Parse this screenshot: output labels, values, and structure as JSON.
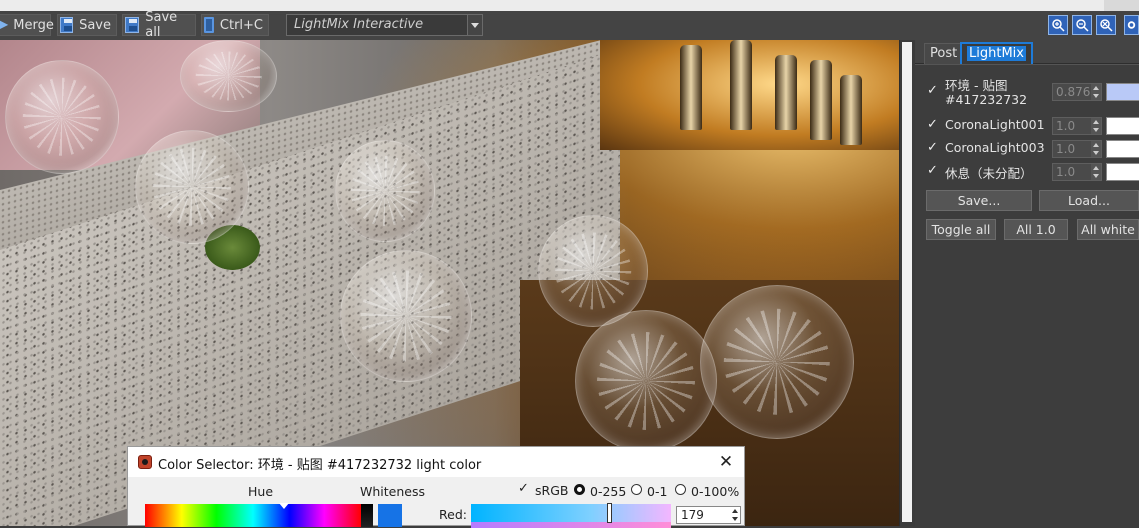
{
  "toolbar": {
    "merge_label": "Merge",
    "save_label": "Save",
    "save_all_label": "Save all",
    "copy_label": "Ctrl+C",
    "lightmix_select_value": "LightMix Interactive"
  },
  "panel": {
    "tabs": [
      {
        "label": "Post",
        "active": false
      },
      {
        "label": "LightMix",
        "active": true
      }
    ],
    "lights": [
      {
        "checked": "✓",
        "name_line1": "环境 - 贴图",
        "name_line2": "#417232732",
        "value": "0.876",
        "color": "#b9c9f7"
      },
      {
        "checked": "✓",
        "name_line1": "CoronaLight001",
        "value": "1.0",
        "color": "#ffffff"
      },
      {
        "checked": "✓",
        "name_line1": "CoronaLight003",
        "value": "1.0",
        "color": "#ffffff"
      },
      {
        "checked": "✓",
        "name_line1": "休息（未分配）",
        "value": "1.0",
        "color": "#ffffff"
      }
    ],
    "save_button": "Save...",
    "load_button": "Load...",
    "toggle_all_button": "Toggle all",
    "all_one_button": "All 1.0",
    "all_white_button": "All white"
  },
  "color_selector": {
    "title": "Color Selector: 环境 - 贴图 #417232732 light color",
    "close_glyph": "✕",
    "hue_label": "Hue",
    "whiteness_label": "Whiteness",
    "srgb_check": "✓",
    "srgb_label": "sRGB",
    "radio_0_255": "0-255",
    "radio_0_1": "0-1",
    "radio_0_100": "0-100%",
    "selected_range": "0-255",
    "red_label": "Red:",
    "red_value": "179",
    "preview_color": "#1673e6"
  },
  "icons": [
    "merge-icon",
    "save-icon",
    "save-all-icon",
    "copy-icon",
    "zoom-in-icon",
    "zoom-out-icon",
    "zoom-fit-icon",
    "settings-icon",
    "app-icon",
    "close-icon"
  ]
}
